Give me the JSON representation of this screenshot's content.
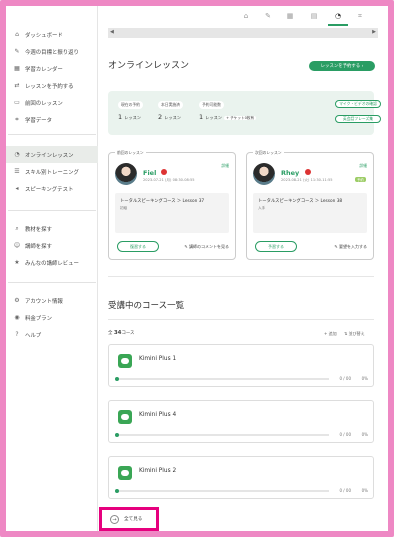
{
  "sidebar": {
    "group1": [
      {
        "label": "ダッシュボード",
        "icon": "home-icon",
        "glyph": "⌂"
      },
      {
        "label": "今週の目標と振り返り",
        "icon": "pencil-icon",
        "glyph": "✎"
      },
      {
        "label": "学習カレンダー",
        "icon": "calendar-icon",
        "glyph": "▦"
      },
      {
        "label": "レッスンを予約する",
        "icon": "reserve-icon",
        "glyph": "⇄"
      },
      {
        "label": "前回のレッスン",
        "icon": "history-icon",
        "glyph": "▭"
      },
      {
        "label": "学習データ",
        "icon": "chart-icon",
        "glyph": "⌗"
      }
    ],
    "group2": [
      {
        "label": "オンラインレッスン",
        "icon": "chat-icon",
        "glyph": "◔",
        "active": true
      },
      {
        "label": "スキル別トレーニング",
        "icon": "training-icon",
        "glyph": "☰"
      },
      {
        "label": "スピーキングテスト",
        "icon": "speaking-icon",
        "glyph": "◂"
      }
    ],
    "group3": [
      {
        "label": "教材を探す",
        "icon": "search-icon",
        "glyph": "⌕"
      },
      {
        "label": "講師を探す",
        "icon": "tutor-icon",
        "glyph": "☺"
      },
      {
        "label": "みんなの講師レビュー",
        "icon": "star-icon",
        "glyph": "★"
      }
    ],
    "group4": [
      {
        "label": "アカウント情報",
        "icon": "account-icon",
        "glyph": "⚙"
      },
      {
        "label": "料金プラン",
        "icon": "plan-icon",
        "glyph": "◉"
      },
      {
        "label": "ヘルプ",
        "icon": "help-icon",
        "glyph": "?"
      }
    ]
  },
  "topnav": {
    "icons": [
      {
        "name": "home-icon",
        "glyph": "⌂"
      },
      {
        "name": "pencil-icon",
        "glyph": "✎"
      },
      {
        "name": "calendar-icon",
        "glyph": "▦"
      },
      {
        "name": "book-icon",
        "glyph": "▤"
      },
      {
        "name": "chat-icon",
        "glyph": "◔",
        "active": true
      },
      {
        "name": "chart-icon",
        "glyph": "⌗"
      }
    ],
    "scroll_left": "◀",
    "scroll_right": "▶"
  },
  "header": {
    "title": "オンラインレッスン",
    "reserve_button": "レッスンを予約する"
  },
  "stats": {
    "items": [
      {
        "label": "現在の予約",
        "value": "1",
        "unit": "レッスン"
      },
      {
        "label": "本日実施済",
        "value": "2",
        "unit": "レッスン"
      },
      {
        "label": "予約可能数",
        "value": "1",
        "unit": "レッスン"
      }
    ],
    "plus_ticket": "+ チケット0枚有",
    "mic_button": "マイク・ビデオの確認",
    "phrase_button": "英会話フレーズ集"
  },
  "lesson_cards": [
    {
      "caption": "前回のレッスン",
      "tutor": "Fiel",
      "detail": "詳細",
      "datetime": "2023-07-21 (月) 08:30-08:55",
      "badge": "",
      "course": "トータルスピーキングコース ＞ Lesson 37",
      "level": "初級",
      "action": "復習する",
      "link": "講師のコメントを見る"
    },
    {
      "caption": "次回のレッスン",
      "tutor": "Rhey",
      "detail": "詳細",
      "datetime": "2023-08-21 (火) 11:30-11:55",
      "badge": "予約",
      "course": "トータルスピーキングコース ＞ Lesson 38",
      "level": "入手",
      "action": "予習する",
      "link": "要望を入力する"
    }
  ],
  "courses": {
    "title": "受講中のコース一覧",
    "count_prefix": "全",
    "count": "34",
    "count_suffix": "コース",
    "add": "+ 追加",
    "sort": "⇅ 並び替え",
    "items": [
      {
        "name": "Kimini Plus 1",
        "progress": "0 / 00",
        "percent": "0%"
      },
      {
        "name": "Kimini Plus 4",
        "progress": "0 / 00",
        "percent": "0%"
      },
      {
        "name": "Kimini Plus 2",
        "progress": "0 / 00",
        "percent": "0%"
      }
    ],
    "see_all": "全て見る",
    "see_all_icon": "→"
  }
}
